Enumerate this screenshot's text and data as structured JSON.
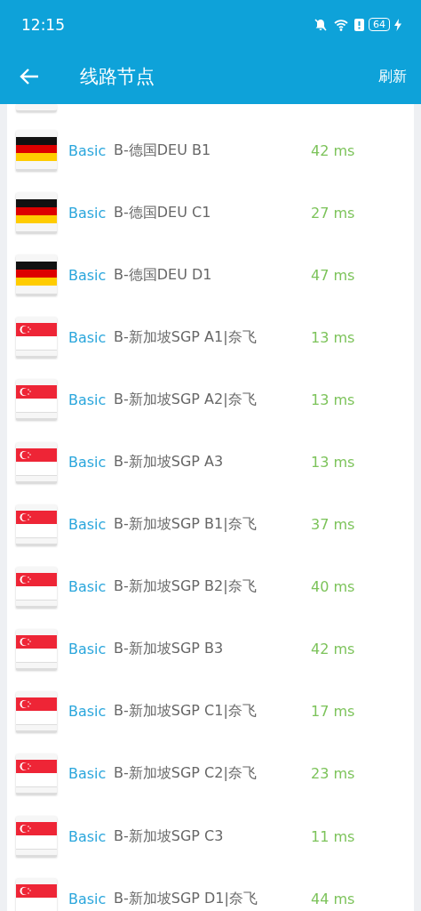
{
  "status_bar": {
    "time": "12:15",
    "battery": "64"
  },
  "toolbar": {
    "title": "线路节点",
    "action": "刷新"
  },
  "nodes": [
    {
      "kind": "de",
      "tier": "Basic",
      "name": "B-德国DEU B1",
      "latency": "42 ms"
    },
    {
      "kind": "de",
      "tier": "Basic",
      "name": "B-德国DEU C1",
      "latency": "27 ms"
    },
    {
      "kind": "de",
      "tier": "Basic",
      "name": "B-德国DEU D1",
      "latency": "47 ms"
    },
    {
      "kind": "sg",
      "tier": "Basic",
      "name": "B-新加坡SGP A1|奈飞",
      "latency": "13 ms"
    },
    {
      "kind": "sg",
      "tier": "Basic",
      "name": "B-新加坡SGP A2|奈飞",
      "latency": "13 ms"
    },
    {
      "kind": "sg",
      "tier": "Basic",
      "name": "B-新加坡SGP A3",
      "latency": "13 ms"
    },
    {
      "kind": "sg",
      "tier": "Basic",
      "name": "B-新加坡SGP B1|奈飞",
      "latency": "37 ms"
    },
    {
      "kind": "sg",
      "tier": "Basic",
      "name": "B-新加坡SGP B2|奈飞",
      "latency": "40 ms"
    },
    {
      "kind": "sg",
      "tier": "Basic",
      "name": "B-新加坡SGP B3",
      "latency": "42 ms"
    },
    {
      "kind": "sg",
      "tier": "Basic",
      "name": "B-新加坡SGP C1|奈飞",
      "latency": "17 ms"
    },
    {
      "kind": "sg",
      "tier": "Basic",
      "name": "B-新加坡SGP C2|奈飞",
      "latency": "23 ms"
    },
    {
      "kind": "sg",
      "tier": "Basic",
      "name": "B-新加坡SGP C3",
      "latency": "11 ms"
    },
    {
      "kind": "sg",
      "tier": "Basic",
      "name": "B-新加坡SGP D1|奈飞",
      "latency": "44 ms"
    }
  ]
}
